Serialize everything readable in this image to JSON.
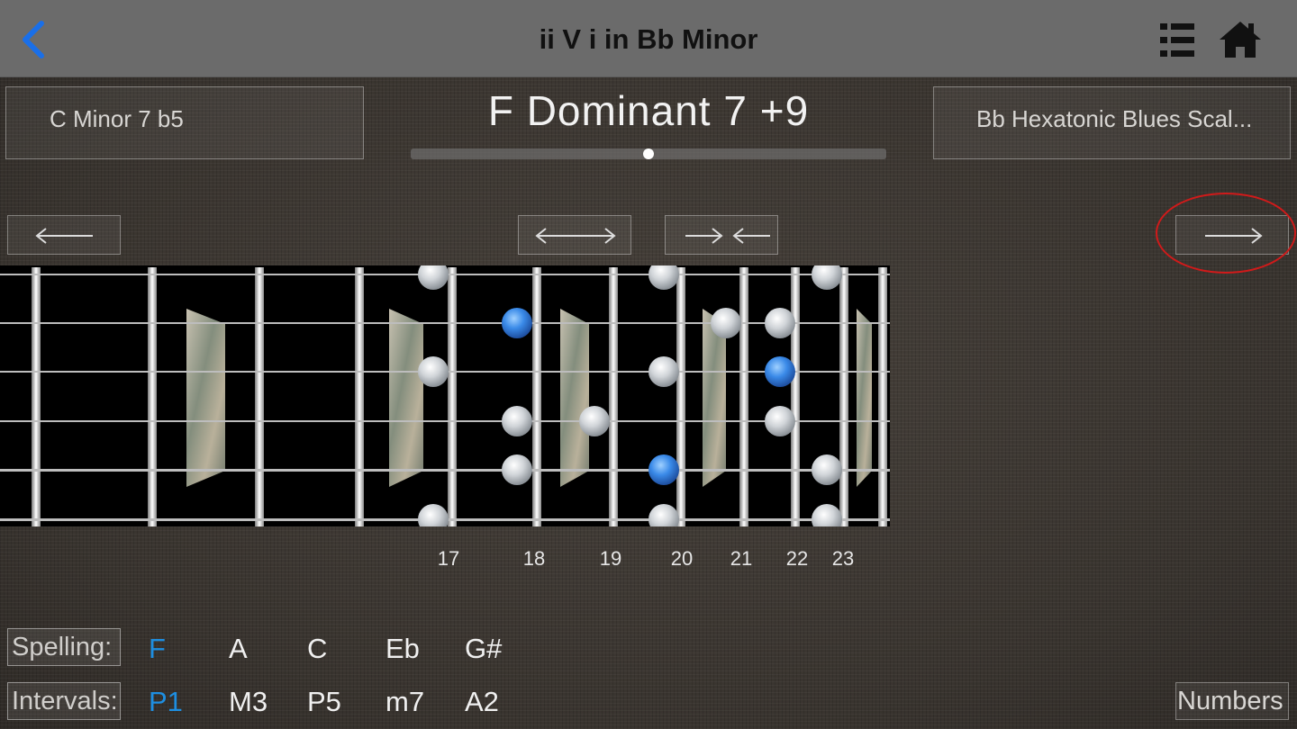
{
  "nav": {
    "title": "ii V i in Bb Minor",
    "back_icon": "chevron-left-icon",
    "list_icon": "list-icon",
    "home_icon": "home-icon",
    "accent": "#1a6fe8"
  },
  "prev_chord": "C  Minor 7 b5",
  "current_chord": "F  Dominant 7 +9",
  "next_scale": "Bb Hexatonic Blues Scal...",
  "fret_numbers": [
    "17",
    "18",
    "19",
    "20",
    "21",
    "22",
    "23"
  ],
  "spelling": {
    "label": "Spelling:",
    "notes": [
      "F",
      "A",
      "C",
      "Eb",
      "G#"
    ]
  },
  "intervals": {
    "label": "Intervals:",
    "values": [
      "P1",
      "M3",
      "P5",
      "m7",
      "A2"
    ]
  },
  "numbers_button": "Numbers",
  "colors": {
    "root_note": "#1e8ee0",
    "highlight_ring": "#d01a1a"
  }
}
